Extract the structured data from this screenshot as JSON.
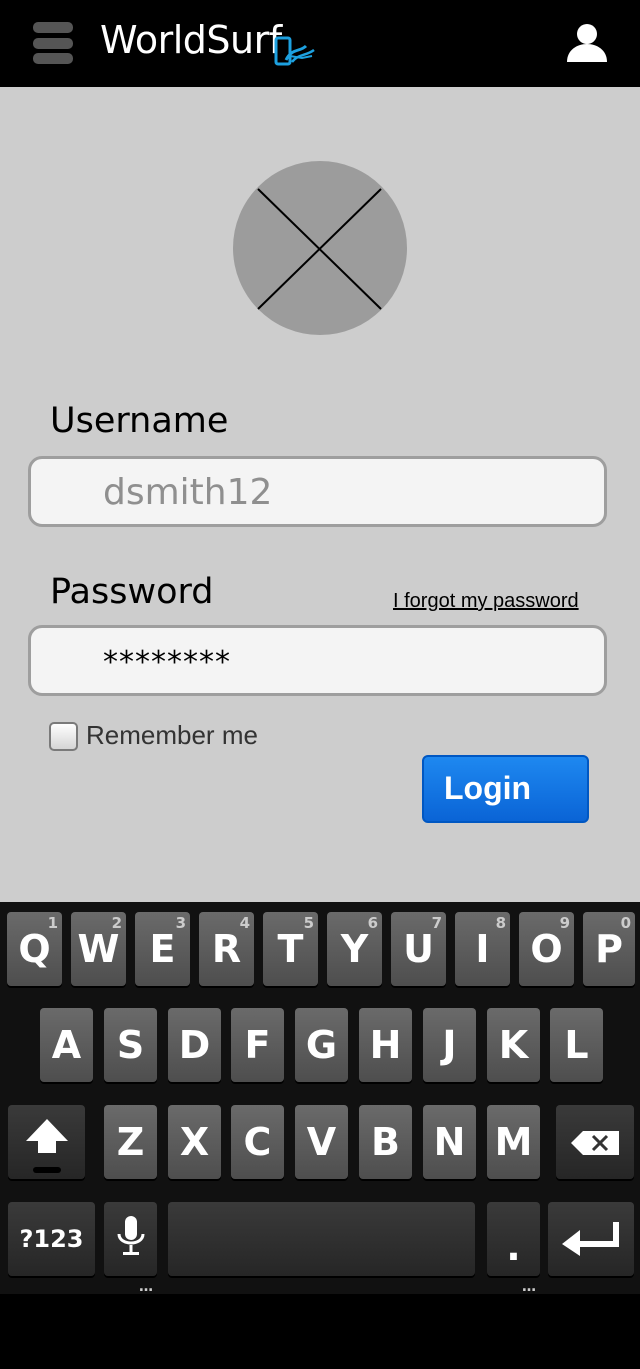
{
  "app": {
    "title": "WorldSurf"
  },
  "login": {
    "username_label": "Username",
    "username_value": "dsmith12",
    "password_label": "Password",
    "password_value": "********",
    "forgot_link": "I forgot my password",
    "remember_label": "Remember me",
    "remember_checked": false,
    "login_button": "Login"
  },
  "keyboard": {
    "row1": [
      {
        "k": "Q",
        "h": "1"
      },
      {
        "k": "W",
        "h": "2"
      },
      {
        "k": "E",
        "h": "3"
      },
      {
        "k": "R",
        "h": "4"
      },
      {
        "k": "T",
        "h": "5"
      },
      {
        "k": "Y",
        "h": "6"
      },
      {
        "k": "U",
        "h": "7"
      },
      {
        "k": "I",
        "h": "8"
      },
      {
        "k": "O",
        "h": "9"
      },
      {
        "k": "P",
        "h": "0"
      }
    ],
    "row2": [
      "A",
      "S",
      "D",
      "F",
      "G",
      "H",
      "J",
      "K",
      "L"
    ],
    "row3": [
      "Z",
      "X",
      "C",
      "V",
      "B",
      "N",
      "M"
    ],
    "symbols_key": "?123",
    "period_key": "."
  },
  "colors": {
    "accent": "#0a74e0",
    "background": "#cdcdcd",
    "header": "#000000"
  },
  "icons": {
    "menu": "hamburger-icon",
    "user": "user-icon",
    "avatar": "avatar-placeholder-icon",
    "shift": "shift-icon",
    "backspace": "backspace-icon",
    "mic": "microphone-icon",
    "enter": "enter-icon"
  }
}
